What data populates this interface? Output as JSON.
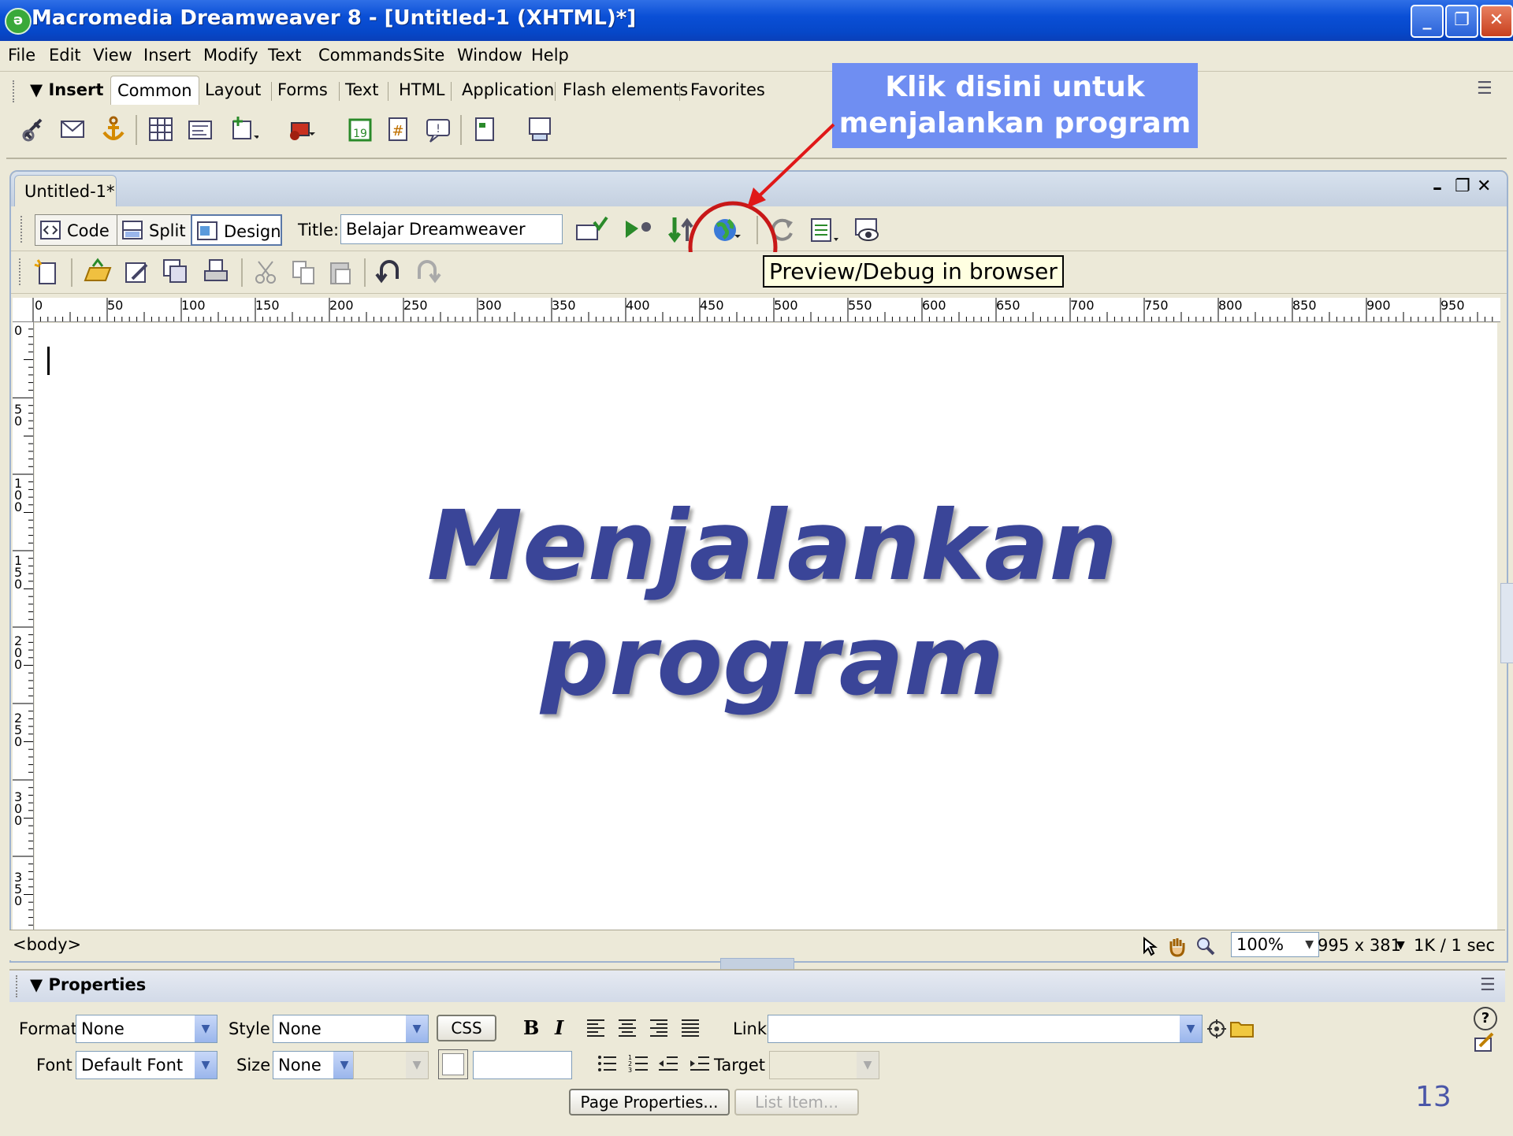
{
  "window": {
    "title": "Macromedia Dreamweaver 8 - [Untitled-1 (XHTML)*]",
    "app_icon": "dreamweaver-icon",
    "controls": {
      "minimize": "_",
      "maximize": "❐",
      "close": "✕"
    }
  },
  "menubar": {
    "items": [
      "File",
      "Edit",
      "View",
      "Insert",
      "Modify",
      "Text",
      "Commands",
      "Site",
      "Window",
      "Help"
    ]
  },
  "insert_bar": {
    "title": "▼ Insert",
    "tabs": [
      "Common",
      "Layout",
      "Forms",
      "Text",
      "HTML",
      "Application",
      "Flash elements",
      "Favorites"
    ],
    "active_tab": "Common"
  },
  "callout": {
    "line1": "Klik disini untuk",
    "line2": "menjalankan program",
    "color": "#6f8ef2"
  },
  "document": {
    "tab_label": "Untitled-1*",
    "view_buttons": {
      "code": "Code",
      "split": "Split",
      "design": "Design"
    },
    "active_view": "Design",
    "title_label": "Title:",
    "title_value": "Belajar Dreamweaver",
    "tooltip": "Preview/Debug in browser",
    "window_controls": {
      "minimize": "–",
      "restore": "❐",
      "close": "✕"
    }
  },
  "ruler": {
    "h_ticks": [
      "0",
      "50",
      "100",
      "150",
      "200",
      "250",
      "300",
      "350",
      "400",
      "450",
      "500",
      "550",
      "600",
      "650",
      "700",
      "750",
      "800",
      "850",
      "900",
      "950"
    ],
    "v_ticks": [
      "0",
      "50",
      "100",
      "150",
      "200",
      "250",
      "300",
      "350"
    ]
  },
  "headline": {
    "line1": "Menjalankan",
    "line2": "program",
    "color": "#3a4598"
  },
  "status": {
    "tag": "<body>",
    "zoom": "100%",
    "window_size": "995 x 381",
    "download": "1K / 1 sec"
  },
  "properties": {
    "title": "▼ Properties",
    "format_label": "Format",
    "format_value": "None",
    "style_label": "Style",
    "style_value": "None",
    "css_button": "CSS",
    "bold": "B",
    "italic": "I",
    "link_label": "Link",
    "font_label": "Font",
    "font_value": "Default Font",
    "size_label": "Size",
    "size_value": "None",
    "target_label": "Target",
    "page_properties": "Page Properties...",
    "list_item": "List Item..."
  },
  "page_number": "13"
}
